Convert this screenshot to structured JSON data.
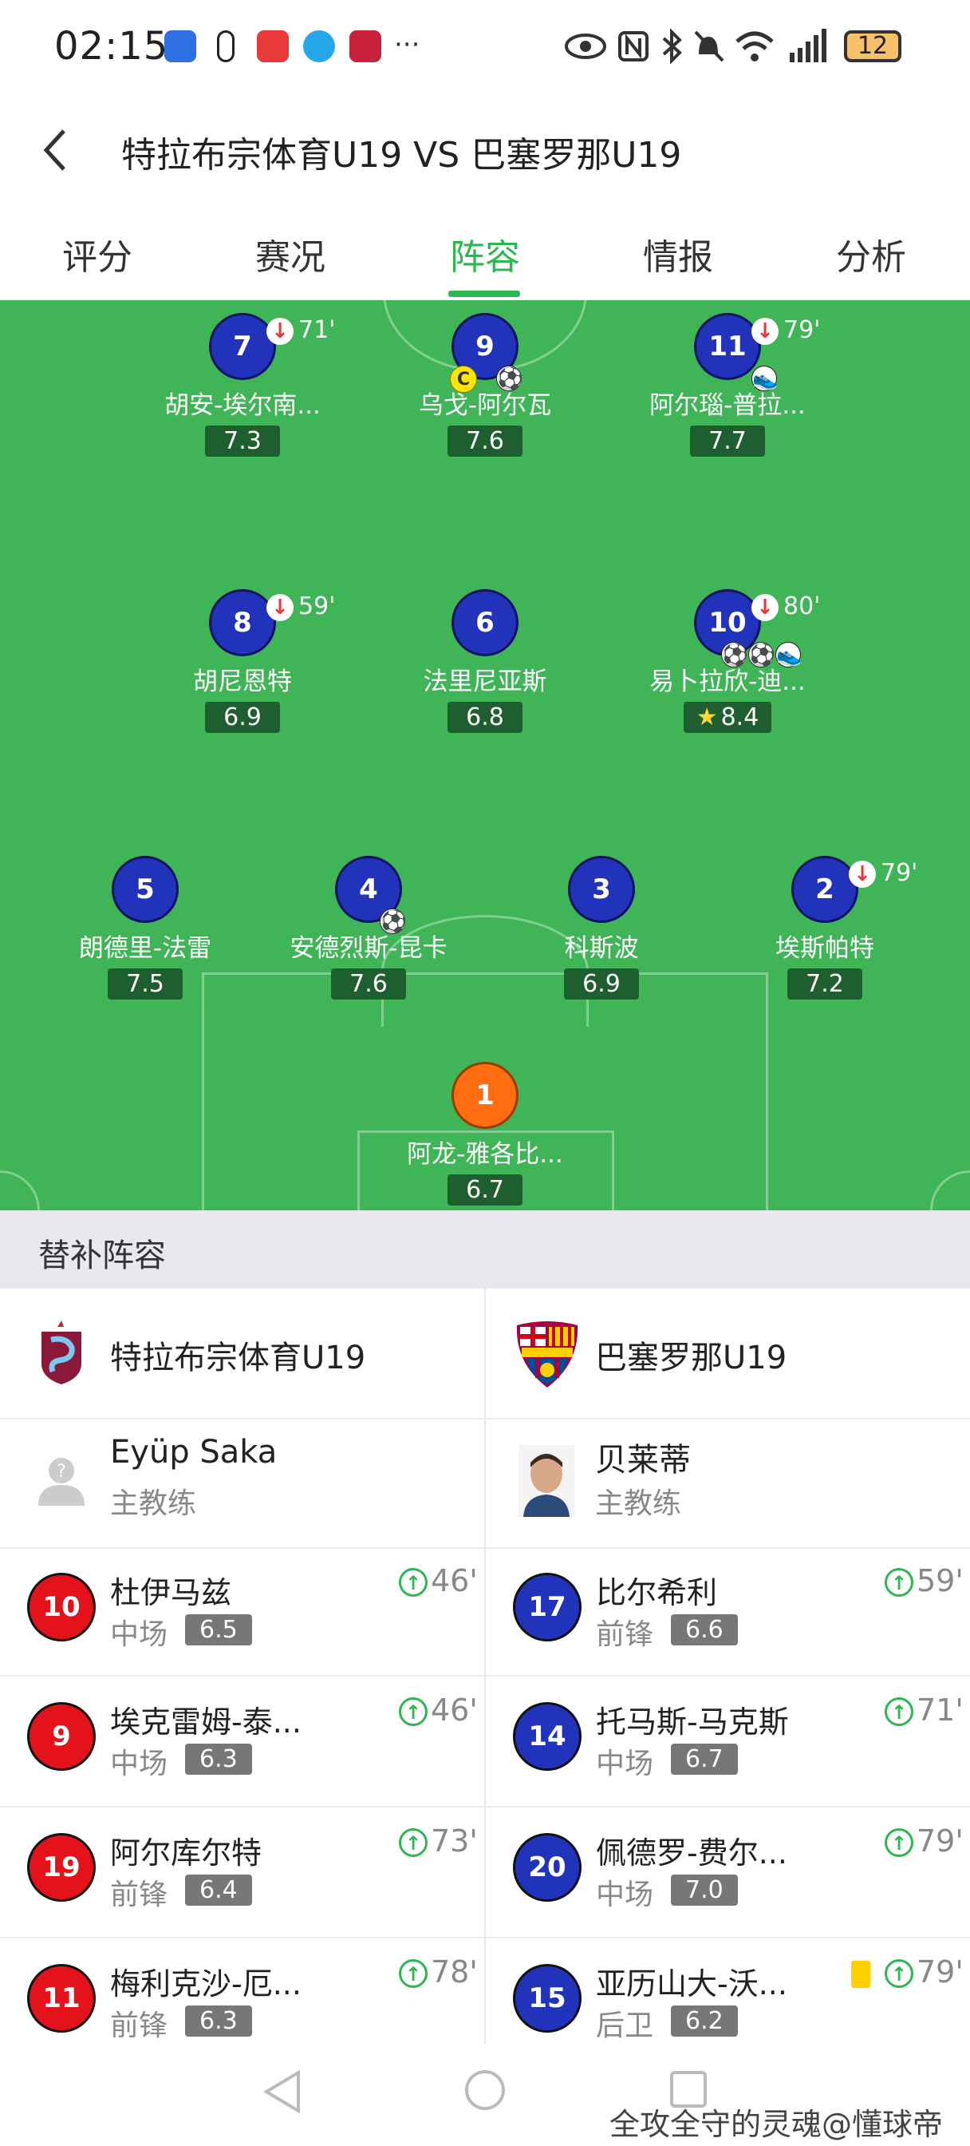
{
  "status": {
    "time": "02:15",
    "more": "···",
    "battery": "12",
    "app_icon_colors": [
      "#2f6fe4",
      "#222222",
      "#e8393b",
      "#25a6e8",
      "#c8223a"
    ]
  },
  "header": {
    "back_icon": "chevron-left",
    "title": "特拉布宗体育U19 VS 巴塞罗那U19"
  },
  "tabs": [
    {
      "label": "评分"
    },
    {
      "label": "赛况"
    },
    {
      "label": "阵容"
    },
    {
      "label": "情报"
    },
    {
      "label": "分析"
    }
  ],
  "lineup": {
    "pitch_color": "#3fb558",
    "players": [
      {
        "number": "7",
        "name": "胡安-埃尔南...",
        "rating": "7.3",
        "sub_out": "71'"
      },
      {
        "number": "9",
        "name": "乌戈-阿尔瓦",
        "rating": "7.6",
        "captain": "C"
      },
      {
        "number": "11",
        "name": "阿尔瑙-普拉...",
        "rating": "7.7",
        "sub_out": "79'"
      },
      {
        "number": "8",
        "name": "胡尼恩特",
        "rating": "6.9",
        "sub_out": "59'"
      },
      {
        "number": "6",
        "name": "法里尼亚斯",
        "rating": "6.8"
      },
      {
        "number": "10",
        "name": "易卜拉欣-迪...",
        "rating": "8.4",
        "sub_out": "80'",
        "best": true
      },
      {
        "number": "5",
        "name": "朗德里-法雷",
        "rating": "7.5"
      },
      {
        "number": "4",
        "name": "安德烈斯-昆卡",
        "rating": "7.6"
      },
      {
        "number": "3",
        "name": "科斯波",
        "rating": "6.9"
      },
      {
        "number": "2",
        "name": "埃斯帕特",
        "rating": "7.2",
        "sub_out": "79'"
      },
      {
        "number": "1",
        "name": "阿龙-雅各比...",
        "rating": "6.7"
      }
    ]
  },
  "subs": {
    "title": "替补阵容",
    "home": {
      "team": "特拉布宗体育U19",
      "coach_name": "Eyüp Saka",
      "coach_role": "主教练",
      "players": [
        {
          "number": "10",
          "name": "杜伊马兹",
          "pos": "中场",
          "rating": "6.5",
          "in": "46'"
        },
        {
          "number": "9",
          "name": "埃克雷姆-泰...",
          "pos": "中场",
          "rating": "6.3",
          "in": "46'"
        },
        {
          "number": "19",
          "name": "阿尔库尔特",
          "pos": "前锋",
          "rating": "6.4",
          "in": "73'"
        },
        {
          "number": "11",
          "name": "梅利克沙-厄...",
          "pos": "前锋",
          "rating": "6.3",
          "in": "78'"
        }
      ]
    },
    "away": {
      "team": "巴塞罗那U19",
      "coach_name": "贝莱蒂",
      "coach_role": "主教练",
      "players": [
        {
          "number": "17",
          "name": "比尔希利",
          "pos": "前锋",
          "rating": "6.6",
          "in": "59'"
        },
        {
          "number": "14",
          "name": "托马斯-马克斯",
          "pos": "中场",
          "rating": "6.7",
          "in": "71'"
        },
        {
          "number": "20",
          "name": "佩德罗-费尔...",
          "pos": "中场",
          "rating": "7.0",
          "in": "79'"
        },
        {
          "number": "15",
          "name": "亚历山大-沃...",
          "pos": "后卫",
          "rating": "6.2",
          "in": "79'"
        }
      ]
    }
  },
  "watermark": "全攻全守的灵魂@懂球帝"
}
